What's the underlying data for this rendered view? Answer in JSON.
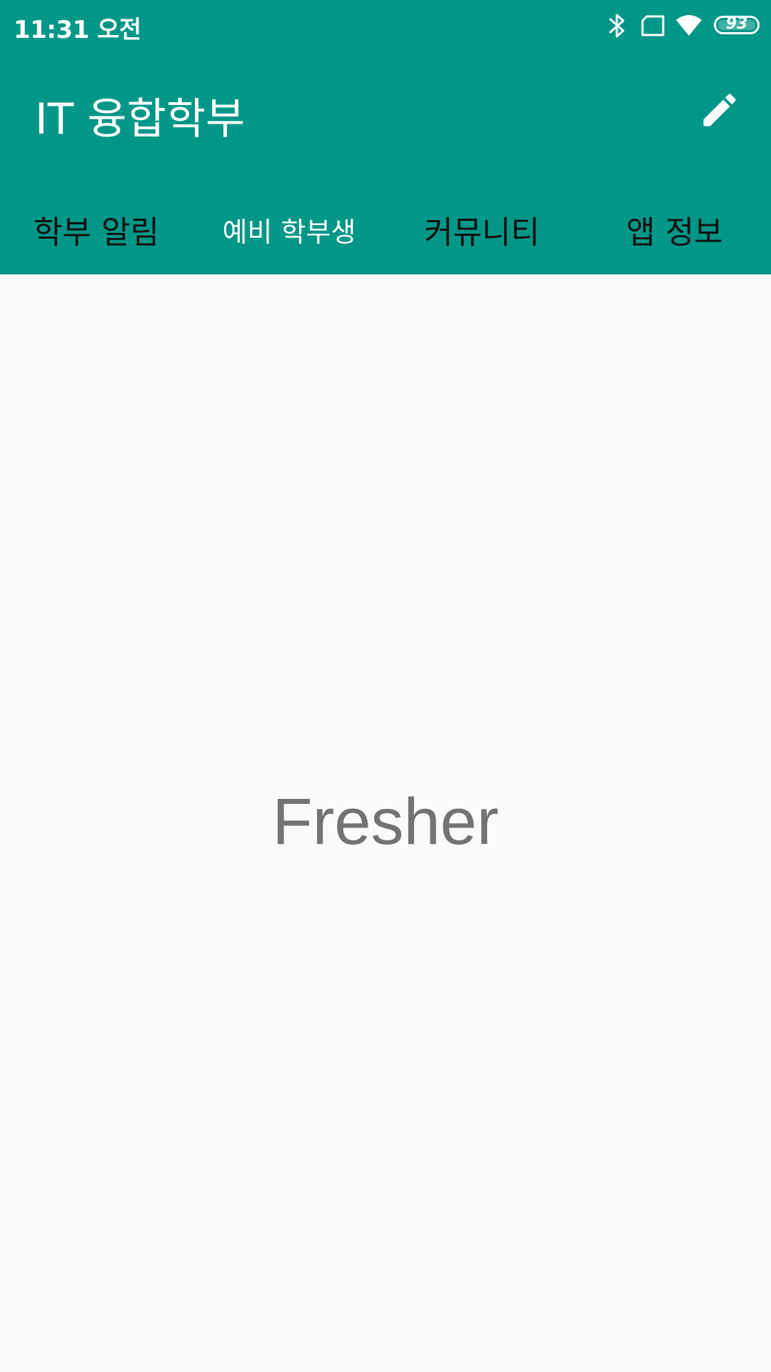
{
  "status_bar": {
    "time": "11:31 오전",
    "icons": [
      "bluetooth-icon",
      "sim-card-icon",
      "wifi-icon",
      "battery-icon"
    ],
    "battery_level": "93"
  },
  "app_bar": {
    "title": "IT 융합학부",
    "action_icon": "pencil-icon",
    "background_color": "#009688"
  },
  "tabs": [
    {
      "label": "학부 알림",
      "selected": false
    },
    {
      "label": "예비 학부생",
      "selected": true
    },
    {
      "label": "커뮤니티",
      "selected": false
    },
    {
      "label": "앱 정보",
      "selected": false
    }
  ],
  "content": {
    "text": "Fresher"
  }
}
